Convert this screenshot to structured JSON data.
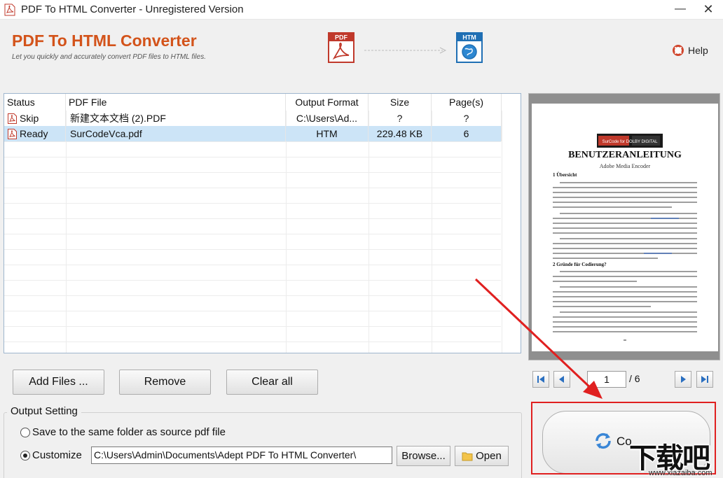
{
  "window": {
    "title": "PDF To HTML Converter - Unregistered Version",
    "minimize_glyph": "—",
    "close_glyph": "✕"
  },
  "header": {
    "brand_title": "PDF To HTML Converter",
    "brand_subtitle": "Let you quickly and accurately convert PDF files to HTML  files.",
    "pdf_logo_label": "PDF",
    "htm_logo_label": "HTM",
    "help_label": "Help"
  },
  "table": {
    "columns": [
      "Status",
      "PDF File",
      "Output Format",
      "Size",
      "Page(s)"
    ],
    "rows": [
      {
        "status": "Skip",
        "file": "新建文本文档 (2).PDF",
        "format": "C:\\Users\\Ad...",
        "size": "?",
        "pages": "?",
        "selected": false
      },
      {
        "status": "Ready",
        "file": "SurCodeVca.pdf",
        "format": "HTM",
        "size": "229.48 KB",
        "pages": "6",
        "selected": true
      }
    ]
  },
  "preview": {
    "doc_logo": "SurCode for DOLBY DIGITAL",
    "doc_title": "BENUTZERANLEITUNG",
    "doc_subtitle": "Adobe Media Encoder",
    "section1": "1  Übersicht",
    "section2": "2  Gründe für Codierung?",
    "current_page": "1",
    "total_pages": "/ 6"
  },
  "buttons": {
    "add_files": "Add Files ...",
    "remove": "Remove",
    "clear_all": "Clear all",
    "browse": "Browse...",
    "open": "Open",
    "convert": "Co"
  },
  "output_setting": {
    "title": "Output Setting",
    "option_same_folder": "Save to the same folder as source pdf file",
    "option_customize": "Customize",
    "selected_option": "customize",
    "path": "C:\\Users\\Admin\\Documents\\Adept PDF To HTML Converter\\"
  },
  "watermark": {
    "big": "下载吧",
    "small": "www.xiazaiba.com"
  },
  "colors": {
    "brand": "#d3531a",
    "selection": "#cce4f7",
    "highlight_frame": "#e02020"
  }
}
